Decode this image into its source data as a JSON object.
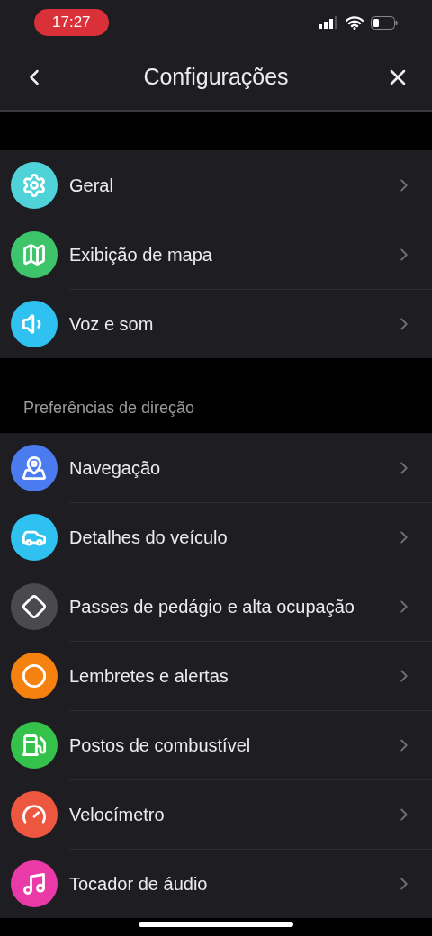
{
  "status_bar": {
    "time": "17:27"
  },
  "header": {
    "title": "Configurações"
  },
  "sections": [
    {
      "items": [
        {
          "label": "Geral",
          "color": "#4fd3d9"
        },
        {
          "label": "Exibição de mapa",
          "color": "#3ec56c"
        },
        {
          "label": "Voz e som",
          "color": "#2fc1f0"
        }
      ]
    },
    {
      "title": "Preferências de direção",
      "items": [
        {
          "label": "Navegação",
          "color": "#4a7cf0"
        },
        {
          "label": "Detalhes do veículo",
          "color": "#2fc1f0"
        },
        {
          "label": "Passes de pedágio e alta ocupação",
          "color": "#4a494e"
        },
        {
          "label": "Lembretes e alertas",
          "color": "#f5820f"
        },
        {
          "label": "Postos de combustível",
          "color": "#35c24a"
        },
        {
          "label": "Velocímetro",
          "color": "#ee573f"
        },
        {
          "label": "Tocador de áudio",
          "color": "#e93aa8"
        }
      ]
    }
  ]
}
